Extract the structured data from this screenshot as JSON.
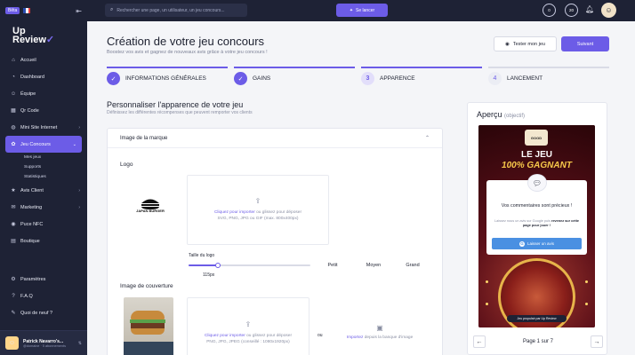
{
  "topbar": {
    "beta": "Bêta",
    "search_placeholder": "Rechercher une page, un utilisateur, un jeu concours...",
    "launch_label": "Se lancer",
    "circle1": "0",
    "circle2": "20"
  },
  "brand": {
    "line1": "Up",
    "line2": "Review"
  },
  "sidebar": {
    "items": [
      {
        "label": "Accueil",
        "icon": "home-icon"
      },
      {
        "label": "Dashboard",
        "icon": "dashboard-icon"
      },
      {
        "label": "Équipe",
        "icon": "team-icon"
      },
      {
        "label": "Qr Code",
        "icon": "qrcode-icon"
      },
      {
        "label": "Mini Site Internet",
        "icon": "globe-icon"
      },
      {
        "label": "Jeu Concours",
        "icon": "gift-icon"
      },
      {
        "label": "Avis Client",
        "icon": "star-icon"
      },
      {
        "label": "Marketing",
        "icon": "megaphone-icon"
      },
      {
        "label": "Puce NFC",
        "icon": "nfc-icon"
      },
      {
        "label": "Boutique",
        "icon": "shop-icon"
      }
    ],
    "sub_items": [
      "Mes jeux",
      "Supports",
      "Statistiques"
    ],
    "bottom_items": [
      {
        "label": "Paramètres",
        "icon": "gear-icon"
      },
      {
        "label": "F.A.Q",
        "icon": "help-icon"
      },
      {
        "label": "Quoi de neuf ?",
        "icon": "news-icon"
      }
    ],
    "user": {
      "name": "Patrick Navarro's...",
      "mail": "@domaine · 5 abonnements"
    }
  },
  "header": {
    "title": "Création de votre jeu concours",
    "subtitle": "Boostez vos avis et gagnez de nouveaux avis grâce à votre jeu concours !",
    "test_label": "Tester mon jeu",
    "next_label": "Suivant"
  },
  "steps": [
    {
      "num": "✓",
      "label": "INFORMATIONS GÉNÉRALES",
      "state": "done"
    },
    {
      "num": "✓",
      "label": "GAINS",
      "state": "done"
    },
    {
      "num": "3",
      "label": "APPARENCE",
      "state": "current"
    },
    {
      "num": "4",
      "label": "LANCEMENT",
      "state": "todo"
    }
  ],
  "section": {
    "title": "Personnaliser l'apparence de votre jeu",
    "subtitle": "Définissez les différentes récompenses que peuvent remporter vos clients"
  },
  "brand_card": {
    "header": "Image de la marque",
    "logo_label": "Logo",
    "logo_text": "JAPAN BURGER",
    "drop1_link": "Cliquez pour importer",
    "drop1_rest": " ou glissez pour déposer",
    "drop1_formats": "SVG, PNG, JPG ou GIF (max. 800x400px)",
    "size_label": "Taille du logo",
    "size_value": "115px",
    "size_fraction": 0.24,
    "sizes": [
      "Petit",
      "Moyen",
      "Grand"
    ],
    "cover_label": "Image de couverture",
    "drop2_link": "Cliquez pour importer",
    "drop2_rest": " ou glissez pour déposer",
    "drop2_formats": "PNG, JPG, JPEG (conseillé : 1080x1920px)",
    "or": "ou",
    "bank_link": "Importez",
    "bank_rest": " depuis la banque d'image"
  },
  "preview": {
    "title": "Aperçu",
    "note": "(objectif)",
    "logo_text": "GOOD",
    "line1": "LE JEU",
    "line2": "100% GAGNANT",
    "modal_title": "Vos commentaires sont précieux !",
    "modal_desc_1": "Laissez nous un avis sur Google puis",
    "modal_desc_bold": "revenez sur cette page pour jouer !",
    "modal_btn": "Laisser un avis",
    "powered": "Jeu propulsé par Up Review",
    "pager": "Page 1 sur 7"
  },
  "colors": {
    "accent": "#6c5ce7",
    "sidebar": "#1e2235",
    "google_blue": "#4a90e2"
  }
}
